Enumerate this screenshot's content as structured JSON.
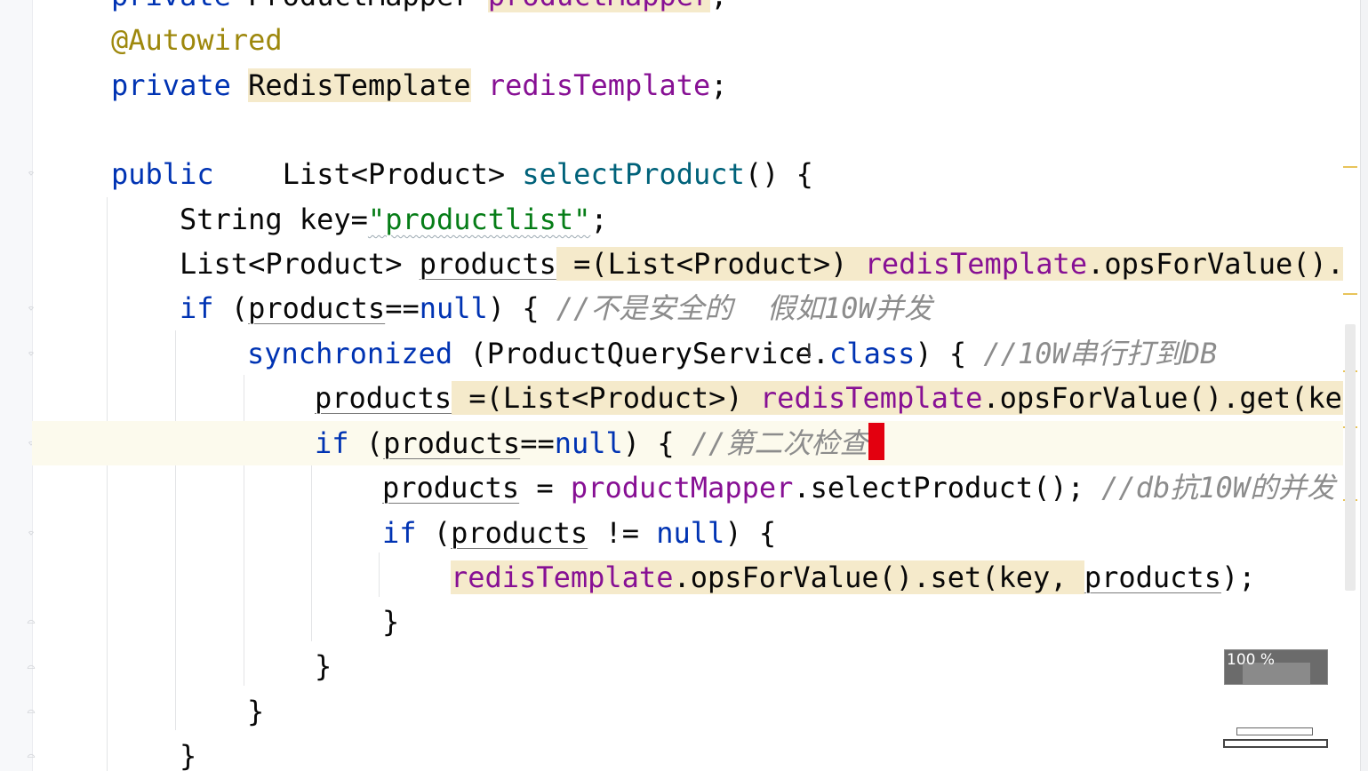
{
  "app": "IntelliJ IDEA editor",
  "colors": {
    "keyword": "#0033b3",
    "annotation": "#9e880d",
    "field": "#871094",
    "method": "#00627a",
    "string": "#067d17",
    "comment": "#8c8c8c",
    "usage_highlight": "#f5eacb",
    "caret": "#e3000f",
    "current_line": "#fcfaed"
  },
  "code": {
    "l0": {
      "kw": "private",
      "type": "ProductMapper",
      "name": "productMapper",
      "end": ";"
    },
    "l1": {
      "ann": "@Autowired"
    },
    "l2": {
      "kw": "private",
      "type": "RedisTemplate",
      "name": "redisTemplate",
      "end": ";"
    },
    "l3": {},
    "l4": {
      "kw": "public",
      "type": "List<Product>",
      "method": "selectProduct",
      "end": "() {"
    },
    "l5": {
      "type": "String",
      "eq": " key=",
      "str": "\"productlist\"",
      "end": ";"
    },
    "l6": {
      "type": "List<Product>",
      "var": "products",
      "cast": " =(List<Product>) ",
      "field": "redisTemplate",
      "rest": ".opsForValue().ge"
    },
    "l7": {
      "kw": "if",
      "open": " (",
      "var": "products",
      "op": "==",
      "null": "null",
      "close": ") { ",
      "comment": "//不是安全的  假如10W并发"
    },
    "l8": {
      "kw": "synchronized",
      "open": " (ProductQueryService.",
      "cls": "class",
      "close": ") { ",
      "comment": "//10W串行打到DB"
    },
    "l9": {
      "var": "products",
      "cast": " =(List<Product>) ",
      "field": "redisTemplate",
      "rest": ".opsForValue().get(key)"
    },
    "l10": {
      "kw": "if",
      "open": " (",
      "var": "products",
      "op": "==",
      "null": "null",
      "close": ") { ",
      "comment": "//第二次检查"
    },
    "l11": {
      "var": "products",
      "eq": " = ",
      "field": "productMapper",
      "rest": ".selectProduct(); ",
      "comment": "//db抗10W的并发"
    },
    "l12": {
      "kw": "if",
      "open": " (",
      "var": "products",
      "op": " != ",
      "null": "null",
      "close": ") {"
    },
    "l13": {
      "field": "redisTemplate",
      "rest": ".opsForValue().set(key, ",
      "var": "products",
      "end": ");"
    },
    "l14": {
      "text": "}"
    },
    "l15": {
      "text": "}"
    },
    "l16": {
      "text": "}"
    },
    "l17": {
      "text": "}"
    }
  },
  "zoom_label": "100 %"
}
